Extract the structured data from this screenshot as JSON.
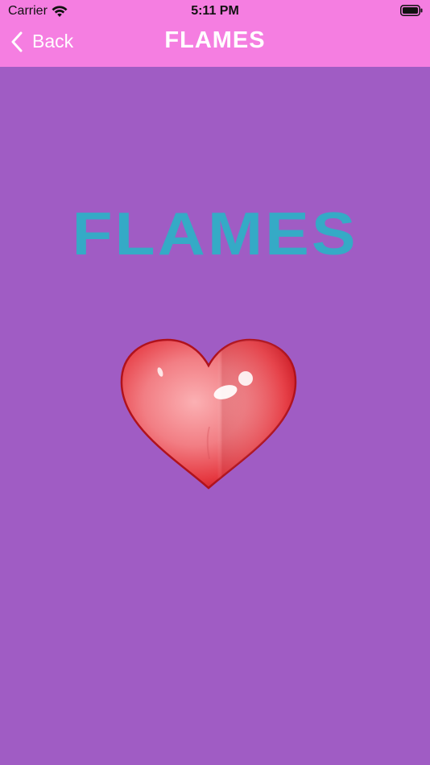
{
  "status_bar": {
    "carrier": "Carrier",
    "time": "5:11 PM",
    "wifi_icon": "wifi-icon",
    "battery_icon": "battery-icon"
  },
  "nav_bar": {
    "back_label": "Back",
    "back_icon": "chevron-left-icon",
    "title": "FLAMES"
  },
  "main": {
    "heading": "FLAMES",
    "image": "heart-image"
  },
  "colors": {
    "nav_background": "#f57ee1",
    "page_background": "#a05cc4",
    "heading_color": "#35aac6",
    "heart_color": "#e8262f"
  }
}
